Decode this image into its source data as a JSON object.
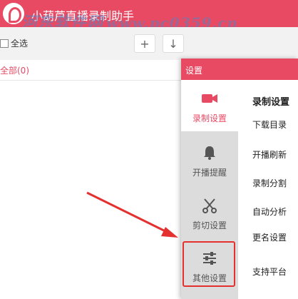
{
  "titlebar": {
    "title": "小葫芦直播录制助手"
  },
  "watermark": {
    "text": "河东软件网",
    "url": "www.pc0359.cn"
  },
  "toolbar": {
    "select_all_label": "全选",
    "add_symbol": "+",
    "download_symbol": "↓",
    "pause_symbol": "| |"
  },
  "filter": {
    "all_label": "全部(0)"
  },
  "dialog": {
    "title": "设置",
    "nav": [
      {
        "label": "录制设置",
        "icon": "video-camera-icon",
        "active": true
      },
      {
        "label": "开播提醒",
        "icon": "bell-icon",
        "active": false
      },
      {
        "label": "剪切设置",
        "icon": "scissors-icon",
        "active": false
      },
      {
        "label": "其他设置",
        "icon": "sliders-icon",
        "active": false,
        "highlighted": true
      }
    ],
    "section_title": "录制设置",
    "rows": [
      "下载目录",
      "开播刷新",
      "录制分割",
      "自动分析",
      "更名设置",
      "支持平台"
    ]
  },
  "colors": {
    "accent": "#e84a64",
    "annotation": "#e53030",
    "sidebar_bg": "#dcdcdc"
  }
}
